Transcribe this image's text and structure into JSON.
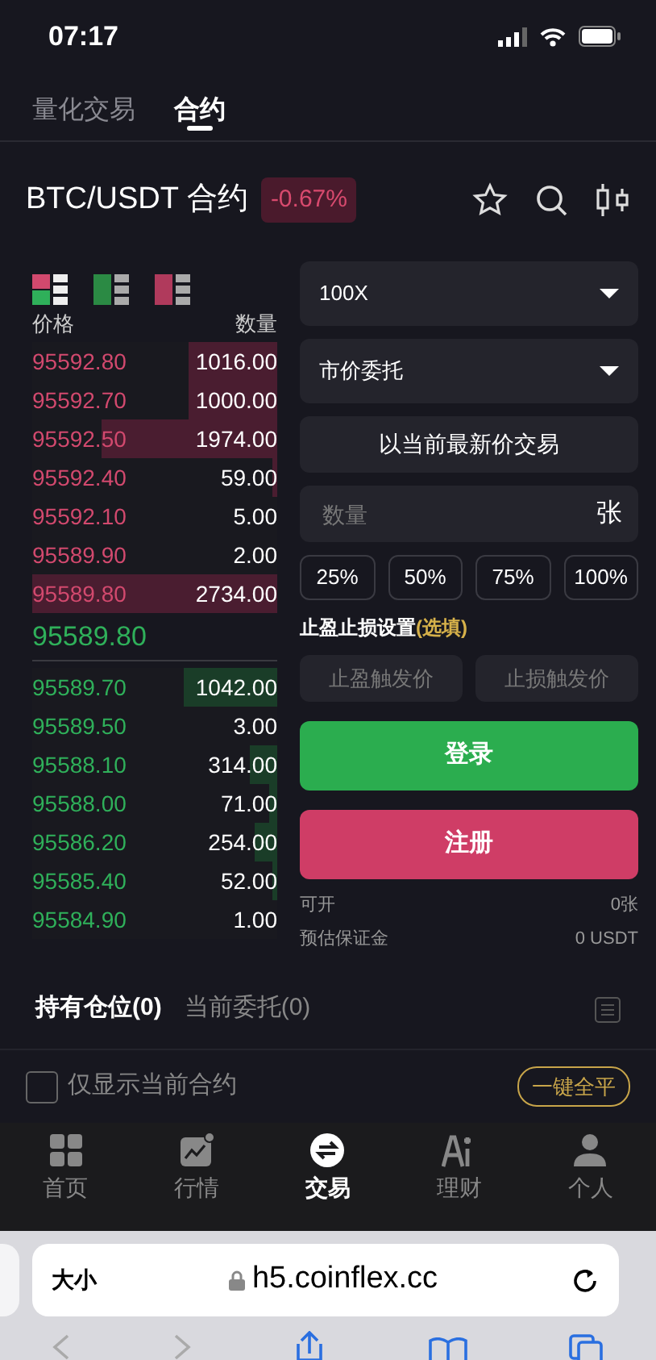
{
  "status_bar": {
    "time": "07:17"
  },
  "top_tabs": [
    {
      "label": "量化交易",
      "selected": false
    },
    {
      "label": "合约",
      "selected": true
    }
  ],
  "header": {
    "title": "BTC/USDT 合约",
    "change": "-0.67%"
  },
  "order_book": {
    "columns": [
      "价格",
      "数量"
    ],
    "asks": [
      {
        "price": "95592.80",
        "amount": "1016.00",
        "level": 0.36
      },
      {
        "price": "95592.70",
        "amount": "1000.00",
        "level": 0.36
      },
      {
        "price": "95592.50",
        "amount": "1974.00",
        "level": 0.72
      },
      {
        "price": "95592.40",
        "amount": "59.00",
        "level": 0.02
      },
      {
        "price": "95592.10",
        "amount": "5.00",
        "level": 0
      },
      {
        "price": "95589.90",
        "amount": "2.00",
        "level": 0
      },
      {
        "price": "95589.80",
        "amount": "2734.00",
        "level": 1
      }
    ],
    "last_price": "95589.80",
    "bids": [
      {
        "price": "95589.70",
        "amount": "1042.00",
        "level": 0.38
      },
      {
        "price": "95589.50",
        "amount": "3.00",
        "level": 0
      },
      {
        "price": "95588.10",
        "amount": "314.00",
        "level": 0.11
      },
      {
        "price": "95588.00",
        "amount": "71.00",
        "level": 0.03
      },
      {
        "price": "95586.20",
        "amount": "254.00",
        "level": 0.09
      },
      {
        "price": "95585.40",
        "amount": "52.00",
        "level": 0.02
      },
      {
        "price": "95584.90",
        "amount": "1.00",
        "level": 0
      }
    ]
  },
  "order_form": {
    "leverage": "100X",
    "order_type": "市价委托",
    "market_price_label": "以当前最新价交易",
    "quantity": {
      "placeholder": "数量",
      "unit": "张"
    },
    "percent_buttons": [
      "25%",
      "50%",
      "75%",
      "100%"
    ],
    "tpsl_label": "止盈止损设置**(选填)**",
    "take_profit": {
      "placeholder": "止盈触发价"
    },
    "stop_loss": {
      "placeholder": "止损触发价"
    },
    "login_button": "登录",
    "register_button": "注册",
    "info": [
      {
        "label": "可开",
        "value": "0张"
      },
      {
        "label": "预估保证金",
        "value": "0 USDT"
      }
    ]
  },
  "position_tabs": [
    {
      "label": "持有仓位(0)",
      "selected": true
    },
    {
      "label": "当前委托(0)",
      "selected": false
    }
  ],
  "filter": {
    "label": "仅显示当前合约",
    "checked": false,
    "close_all": "一键全平"
  },
  "bottom_nav": [
    {
      "label": "首页",
      "selected": false
    },
    {
      "label": "行情",
      "selected": false
    },
    {
      "label": "交易",
      "selected": true
    },
    {
      "label": "理财",
      "selected": false
    },
    {
      "label": "个人",
      "selected": false
    }
  ],
  "browser": {
    "text_size": "大小",
    "url": "h5.coinflex.cc"
  }
}
